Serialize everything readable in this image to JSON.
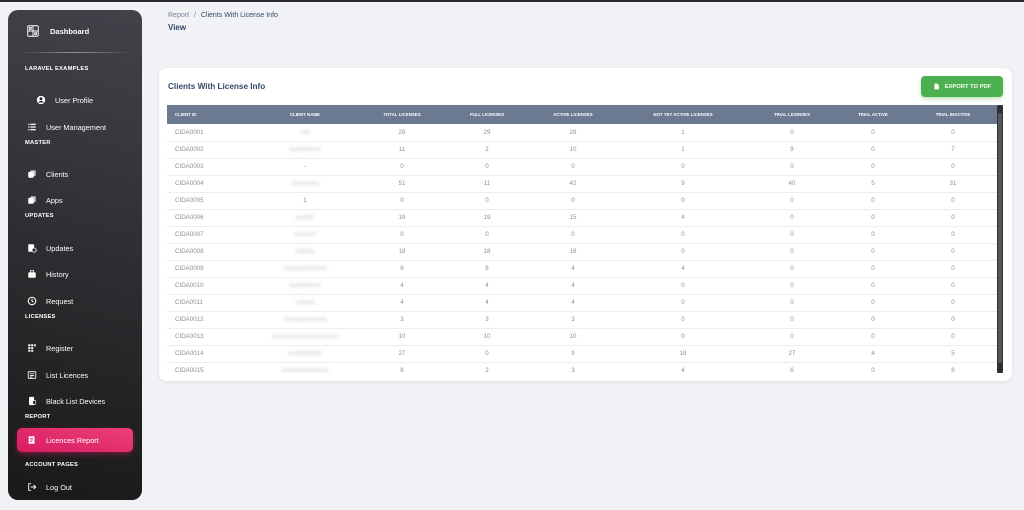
{
  "brand": {
    "title": "Dashboard"
  },
  "sidebar": {
    "sections": [
      {
        "label": "LARAVEL EXAMPLES",
        "items": [
          {
            "label": "User Profile",
            "icon": "user-circle-icon"
          },
          {
            "label": "User Management",
            "icon": "list-icon"
          }
        ]
      },
      {
        "label": "MASTER",
        "items": [
          {
            "label": "Clients",
            "icon": "copy-icon"
          },
          {
            "label": "Apps",
            "icon": "copy-icon"
          }
        ]
      },
      {
        "label": "UPDATES",
        "items": [
          {
            "label": "Updates",
            "icon": "update-icon"
          },
          {
            "label": "History",
            "icon": "briefcase-icon"
          },
          {
            "label": "Request",
            "icon": "clock-icon"
          }
        ]
      },
      {
        "label": "LICENSES",
        "items": [
          {
            "label": "Register",
            "icon": "grid-icon"
          },
          {
            "label": "List Licences",
            "icon": "list-box-icon"
          },
          {
            "label": "Black List Devices",
            "icon": "device-icon"
          }
        ]
      },
      {
        "label": "REPORT",
        "items": [
          {
            "label": "Licences Report",
            "icon": "report-icon",
            "active": true
          }
        ]
      },
      {
        "label": "ACCOUNT PAGES",
        "items": [
          {
            "label": "Log Out",
            "icon": "logout-icon"
          }
        ]
      }
    ]
  },
  "breadcrumb": {
    "parent": "Report",
    "separator": "/",
    "current": "Clients With License Info"
  },
  "page": {
    "title": "View"
  },
  "card": {
    "title": "Clients With License Info",
    "export_label": "EXPORT TO PDF"
  },
  "table": {
    "columns": [
      "CLIENT ID",
      "CLIENT NAME",
      "TOTAL LICENSES",
      "FULL LICENSES",
      "ACTIVE LICENSES",
      "NOT YET ACTIVE LICENSES",
      "TRIAL LICENSES",
      "TRIAL ACTIVE",
      "TRIAL INACTIVE"
    ],
    "rows": [
      [
        "CIDA0001",
        "xxx",
        "29",
        "29",
        "28",
        "1",
        "0",
        "0",
        "0"
      ],
      [
        "CIDA0002",
        "xxxxxxxxxx",
        "11",
        "2",
        "10",
        "1",
        "9",
        "0",
        "7"
      ],
      [
        "CIDA0003",
        "-",
        "0",
        "0",
        "0",
        "0",
        "0",
        "0",
        "0"
      ],
      [
        "CIDA0004",
        "xxxxxxxxx",
        "51",
        "11",
        "42",
        "9",
        "40",
        "5",
        "31"
      ],
      [
        "CIDA0005",
        "1",
        "0",
        "0",
        "0",
        "0",
        "0",
        "0",
        "0"
      ],
      [
        "CIDA0006",
        "xxxxxx",
        "19",
        "19",
        "15",
        "4",
        "0",
        "0",
        "0"
      ],
      [
        "CIDA0007",
        "xxxxxxx",
        "0",
        "0",
        "0",
        "0",
        "0",
        "0",
        "0"
      ],
      [
        "CIDA0008",
        "xxxxxx",
        "18",
        "18",
        "18",
        "0",
        "0",
        "0",
        "0"
      ],
      [
        "CIDA0009",
        "xxxxxxxxxxxxxx",
        "8",
        "8",
        "4",
        "4",
        "0",
        "0",
        "0"
      ],
      [
        "CIDA0010",
        "xxxxxxxxxx",
        "4",
        "4",
        "4",
        "0",
        "0",
        "0",
        "0"
      ],
      [
        "CIDA0011",
        "xxxxxx",
        "4",
        "4",
        "4",
        "0",
        "0",
        "0",
        "0"
      ],
      [
        "CIDA0012",
        "xxxxxxxxxxxxxx",
        "3",
        "3",
        "3",
        "0",
        "0",
        "0",
        "0"
      ],
      [
        "CIDA0013",
        "xxxxxxxxxxxxxxxxxxxxx",
        "10",
        "10",
        "10",
        "0",
        "0",
        "0",
        "0"
      ],
      [
        "CIDA0014",
        "xxxxxxxxxxx",
        "27",
        "0",
        "9",
        "18",
        "27",
        "4",
        "5"
      ],
      [
        "CIDA0015",
        "xxxxxxxxxxxxxxx",
        "8",
        "2",
        "3",
        "4",
        "6",
        "0",
        "6"
      ]
    ]
  },
  "colors": {
    "accent": "#e91e63",
    "export": "#4caf50",
    "sidebar": "#202024",
    "table_header": "#6c7a91"
  }
}
